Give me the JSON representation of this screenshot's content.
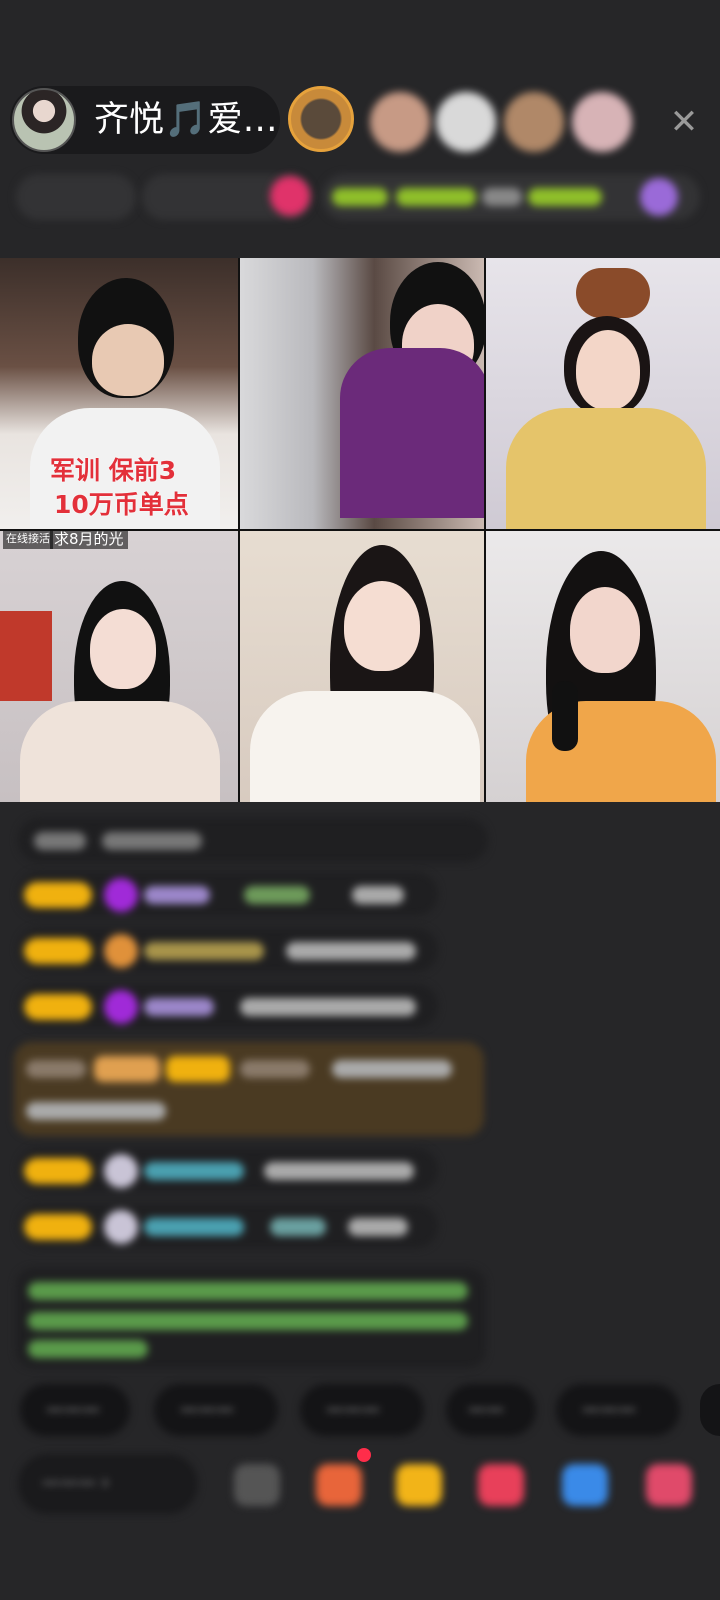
{
  "header": {
    "host_name": "齐悦🎵爱…",
    "close_symbol": "✕",
    "sub_chips": [
      "—",
      "—",
      "—"
    ]
  },
  "grid": {
    "tile1_overlay_line1": "军训 保前3",
    "tile1_overlay_line2": "10万币单点",
    "tile4_tag_left": "在线接活",
    "tile4_tag_right": "求8月的光"
  },
  "chat": {
    "system_placeholder": "",
    "messages_count_visible": 8
  },
  "quick_replies": [
    "",
    "",
    "",
    "",
    ""
  ],
  "toolbar": {
    "say_placeholder": ""
  },
  "colors": {
    "background": "#262628",
    "level_badge": "#f0b10f",
    "overlay_red": "#e3303a"
  }
}
